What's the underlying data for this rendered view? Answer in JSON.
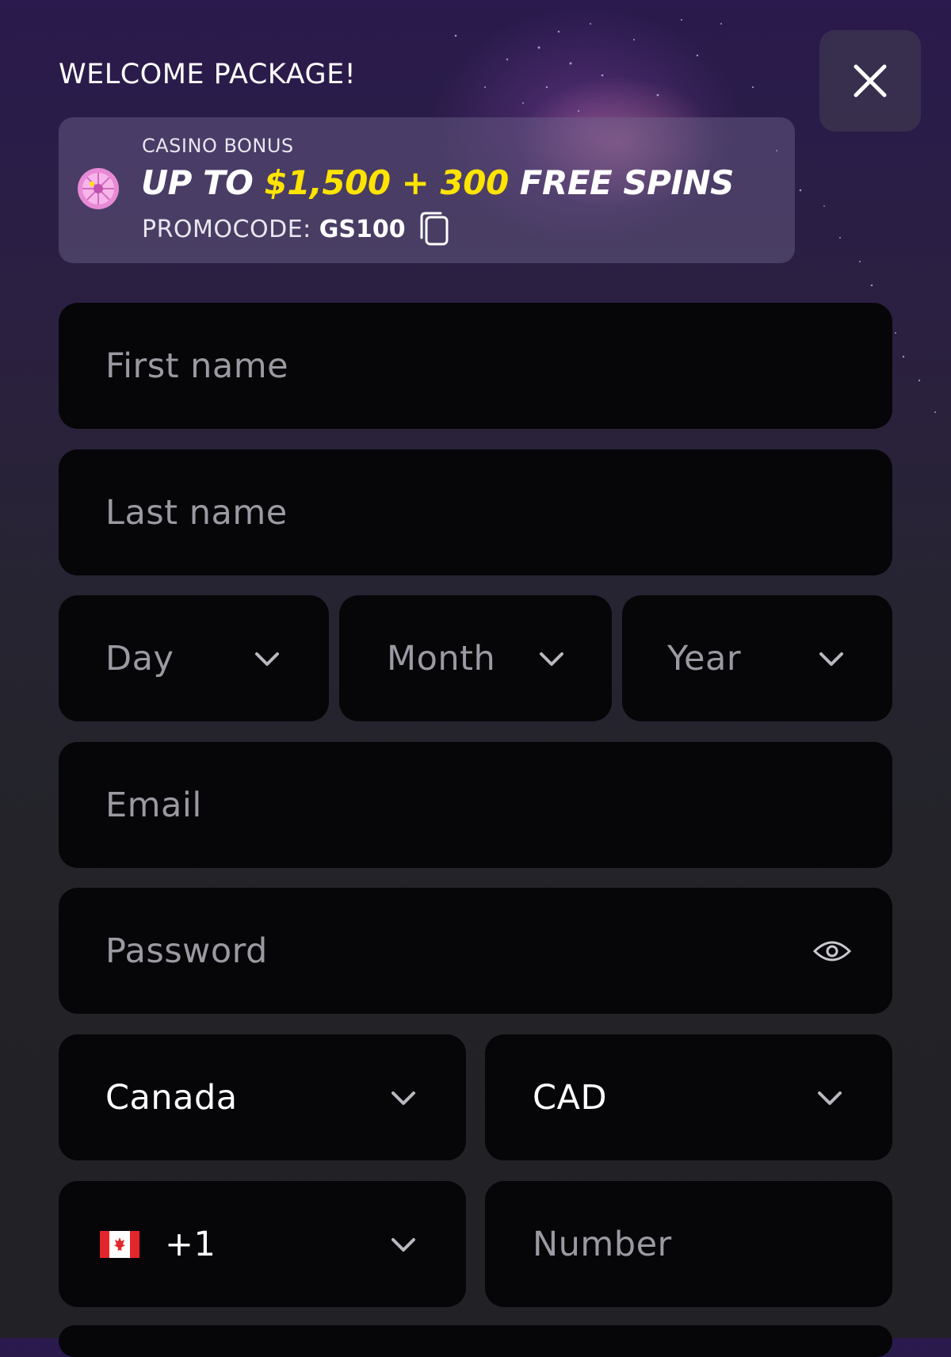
{
  "header": {
    "title": "WELCOME PACKAGE!"
  },
  "bonus": {
    "label": "CASINO BONUS",
    "headline_prefix": "UP TO ",
    "amount": "$1,500 + 300",
    "headline_suffix": " FREE SPINS",
    "promo_label": "PROMOCODE:",
    "promo_code": "GS100",
    "accent_color": "#ffe400"
  },
  "form": {
    "first_name": {
      "placeholder": "First name"
    },
    "last_name": {
      "placeholder": "Last name"
    },
    "dob": {
      "day": "Day",
      "month": "Month",
      "year": "Year"
    },
    "email": {
      "placeholder": "Email"
    },
    "password": {
      "placeholder": "Password"
    },
    "country": {
      "value": "Canada"
    },
    "currency": {
      "value": "CAD"
    },
    "phone_code": {
      "value": "+1",
      "flag": "canada-flag-icon"
    },
    "phone_number": {
      "placeholder": "Number"
    }
  }
}
